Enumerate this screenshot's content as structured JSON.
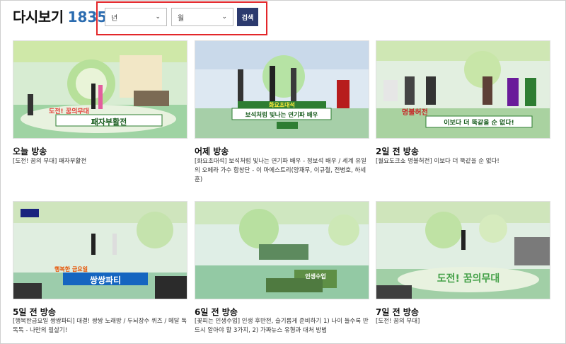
{
  "header": {
    "title": "다시보기",
    "count": "1835"
  },
  "search": {
    "year_label": "년",
    "month_label": "월",
    "button_label": "검색"
  },
  "episodes": [
    {
      "title": "오늘 방송",
      "desc": "[도전! 꿈의 무대] 패자부활전",
      "caption": "패자부활전",
      "tag": "도전! 꿈의무대"
    },
    {
      "title": "어제 방송",
      "desc": "[화요초대석] 보석처럼 빛나는 연기파 배우 - 정보석 배우 / 세계 유일의 오페라 가수 함창단 - 이 마에스트리(양재무, 이규철, 전병호, 하세훈)",
      "caption": "보석처럼 빛나는 연기파 배우",
      "tag": "화요초대석"
    },
    {
      "title": "2일 전 방송",
      "desc": "[월요도크쇼 명불허전] 이보다 더 뚝같을 순 없다!",
      "caption": "이보다 더 뚝같을 순 없다!",
      "tag": "명불허전"
    },
    {
      "title": "5일 전 방송",
      "desc": "[행복한금요일 쌍쌍파티] 대결! 쌍쌍 노래방 / 두뇌장수 퀴즈 / 메달 독독독 - 나만의 필살기!",
      "caption": "쌍쌍파티",
      "tag": "행복한 금요일"
    },
    {
      "title": "6일 전 방송",
      "desc": "[꽃피는 인생수업] 인생 후반전, 슬기롭게 준비하기 1) 나이 들수록 반드시 알아야 할 3가지, 2) 가짜뉴스 유형과 대처 방법",
      "caption": "인생수업",
      "tag": ""
    },
    {
      "title": "7일 전 방송",
      "desc": "[도전! 꿈의 무대]",
      "caption": "도전! 꿈의무대",
      "tag": ""
    }
  ],
  "colors": {
    "accent": "#2b6cb0",
    "button": "#2c3a6e",
    "highlight_border": "#e3262a"
  }
}
